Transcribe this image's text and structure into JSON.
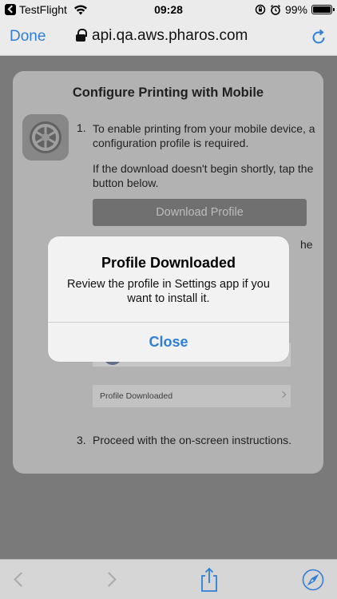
{
  "status_bar": {
    "app": "TestFlight",
    "time": "09:28",
    "battery": "99%",
    "battery_level": 0.99
  },
  "nav": {
    "done_label": "Done",
    "url": "api.qa.aws.pharos.com"
  },
  "page": {
    "title": "Configure Printing with Mobile",
    "step1_number": "1.",
    "step1_text": "To enable printing from your mobile device, a configuration profile is required.",
    "step1_sub": "If the download doesn't begin shortly, tap the button below.",
    "download_button": "Download Profile",
    "step2_fragment": "he",
    "profile_row_label": "Profile Downloaded",
    "step3_number": "3.",
    "step3_text": "Proceed with the on-screen instructions."
  },
  "alert": {
    "title": "Profile Downloaded",
    "message": "Review the profile in Settings app if you want to install it.",
    "close_label": "Close"
  },
  "colors": {
    "accent": "#2f7fd6"
  },
  "icons": [
    "back-arrow-icon",
    "wifi-icon",
    "orientation-lock-icon",
    "alarm-icon",
    "battery-icon",
    "lock-icon",
    "reload-icon",
    "settings-gear-icon",
    "chevron-right-icon",
    "back-icon",
    "forward-icon",
    "share-icon",
    "compass-icon"
  ]
}
